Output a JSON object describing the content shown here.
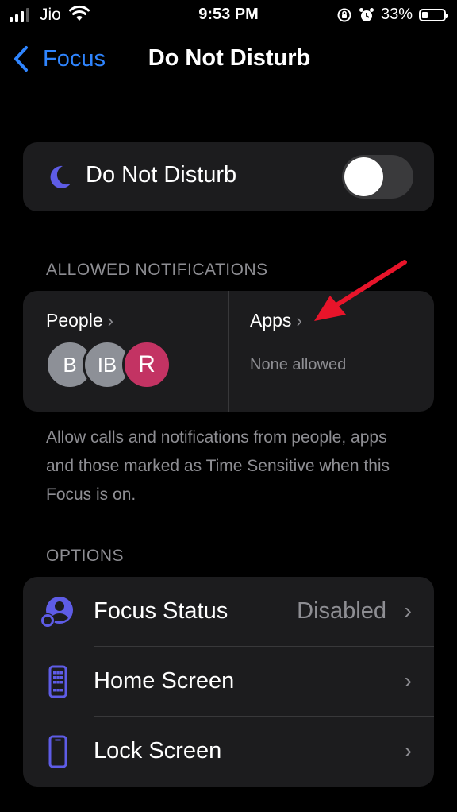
{
  "status_bar": {
    "carrier": "Jio",
    "time": "9:53 PM",
    "battery_percent": "33%",
    "battery_level": 0.33,
    "icons": [
      "signal-icon",
      "wifi-icon",
      "orientation-lock-icon",
      "alarm-icon",
      "battery-icon"
    ]
  },
  "nav": {
    "back_label": "Focus",
    "title": "Do Not Disturb"
  },
  "dnd": {
    "label": "Do Not Disturb",
    "toggle_on": false,
    "icon": "moon-icon"
  },
  "allowed": {
    "header": "ALLOWED NOTIFICATIONS",
    "people_label": "People",
    "people_avatars": [
      "B",
      "IB",
      "R"
    ],
    "apps_label": "Apps",
    "apps_status": "None allowed",
    "description": "Allow calls and notifications from people, apps and those marked as Time Sensitive when this Focus is on."
  },
  "options": {
    "header": "OPTIONS",
    "rows": [
      {
        "label": "Focus Status",
        "value": "Disabled",
        "icon": "focus-status-icon"
      },
      {
        "label": "Home Screen",
        "value": "",
        "icon": "home-screen-icon"
      },
      {
        "label": "Lock Screen",
        "value": "",
        "icon": "lock-screen-icon"
      }
    ]
  },
  "colors": {
    "background": "#000000",
    "card": "#1c1c1e",
    "accent_blue": "#2f85ff",
    "accent_purple": "#5e5ce6",
    "secondary_text": "#8e8e93",
    "avatar_red": "#c33363",
    "annotation_arrow": "#e8142a"
  }
}
